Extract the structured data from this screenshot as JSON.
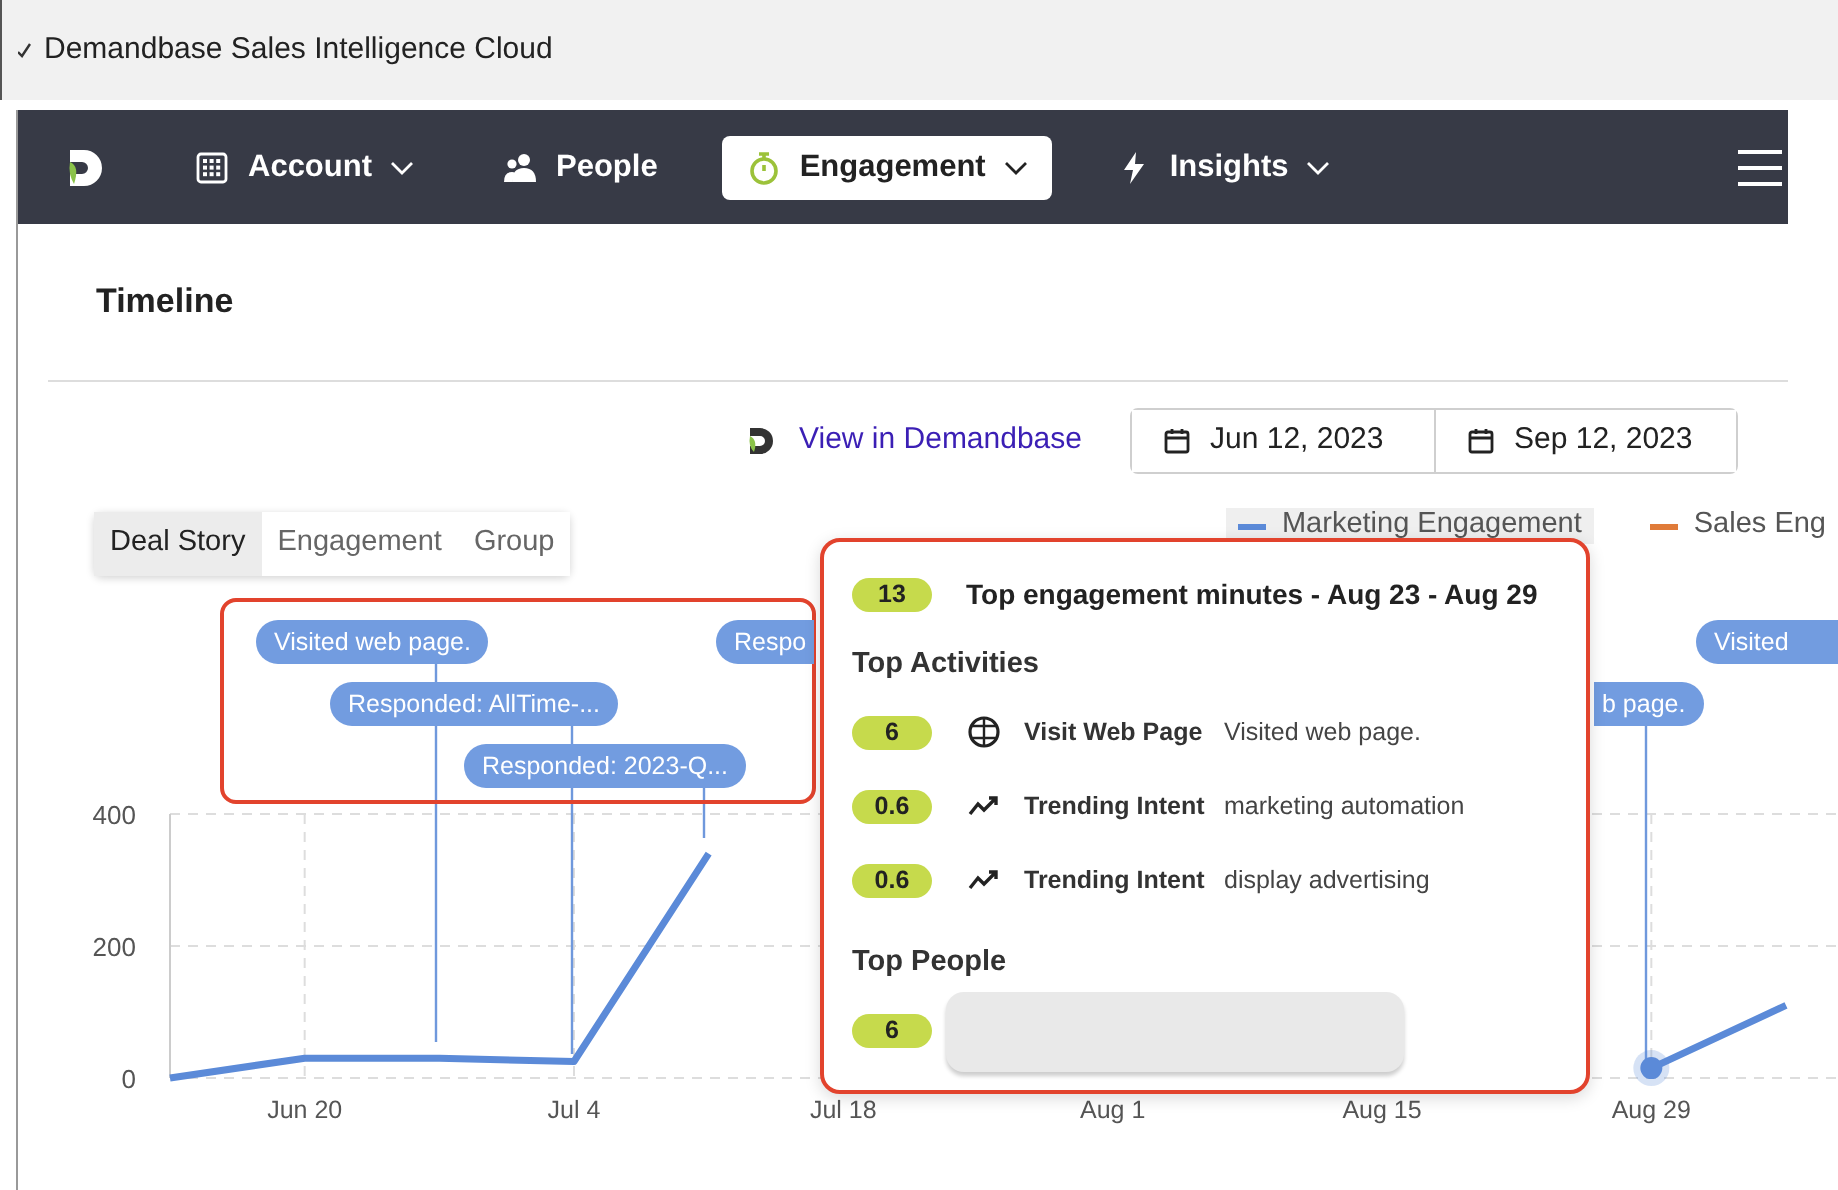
{
  "window": {
    "title": "Demandbase Sales Intelligence Cloud"
  },
  "nav": {
    "items": [
      {
        "label": "Account",
        "kind": "building",
        "dropdown": true,
        "selected": false
      },
      {
        "label": "People",
        "kind": "people",
        "dropdown": false,
        "selected": false
      },
      {
        "label": "Engagement",
        "kind": "stopwatch",
        "dropdown": true,
        "selected": true
      },
      {
        "label": "Insights",
        "kind": "bolt",
        "dropdown": true,
        "selected": false
      }
    ]
  },
  "page": {
    "title": "Timeline"
  },
  "toolbar": {
    "link": "View in Demandbase",
    "date_range": [
      "Jun 12, 2023",
      "Sep 12, 2023"
    ]
  },
  "view_tabs": [
    {
      "label": "Deal Story",
      "selected": true
    },
    {
      "label": "Engagement",
      "selected": false
    },
    {
      "label": "Group",
      "selected": false
    }
  ],
  "events": [
    {
      "label": "Visited web page."
    },
    {
      "label": "Responded: AllTime-..."
    },
    {
      "label": "Responded: 2023-Q..."
    },
    {
      "label": "Respo"
    },
    {
      "label": "b page."
    },
    {
      "label": "Visited"
    }
  ],
  "chart_data": {
    "type": "line",
    "categories": [
      null,
      "Jun 20",
      null,
      "Jul 4",
      null,
      "Jul 18",
      null,
      "Aug 1",
      null,
      "Aug 15",
      null,
      "Aug 29",
      null
    ],
    "series": [
      {
        "name": "Marketing Engagement",
        "color": "#5b8ad8",
        "values": [
          0,
          30,
          30,
          25,
          340,
          null,
          null,
          null,
          null,
          null,
          null,
          15,
          110
        ]
      },
      {
        "name": "Sales Eng",
        "color": "#e07b39",
        "values": [
          null,
          null,
          null,
          null,
          null,
          null,
          null,
          null,
          null,
          null,
          null,
          null,
          null
        ]
      }
    ],
    "ylim": [
      0,
      400
    ],
    "yticks": [
      0,
      200,
      400
    ],
    "grid": true,
    "annotations": [
      {
        "x": "Aug 29"
      }
    ]
  },
  "popover": {
    "badge": "13",
    "title": "Top engagement minutes - Aug 23 - Aug 29",
    "activities_heading": "Top Activities",
    "activities": [
      {
        "score": "6",
        "kind": "web",
        "type": "Visit Web Page",
        "detail": "Visited web page."
      },
      {
        "score": "0.6",
        "kind": "trend",
        "type": "Trending Intent",
        "detail": "marketing automation"
      },
      {
        "score": "0.6",
        "kind": "trend",
        "type": "Trending Intent",
        "detail": "display advertising"
      }
    ],
    "people_heading": "Top People",
    "people": [
      {
        "score": "6"
      }
    ]
  }
}
